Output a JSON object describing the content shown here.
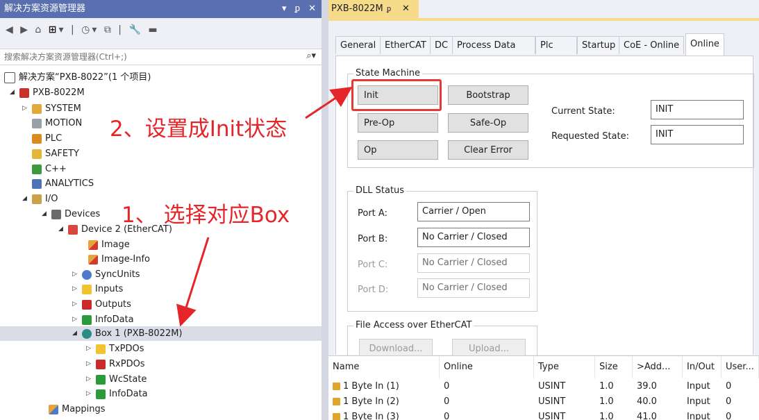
{
  "left_panel": {
    "title": "解决方案资源管理器",
    "title_controls": [
      "▾",
      "ᵱ",
      "✕"
    ],
    "search_placeholder": "搜索解决方案资源管理器(Ctrl+;)",
    "tree": [
      {
        "label": "解决方案“PXB-8022”(1 个项目)",
        "icon": "solution-icon"
      },
      {
        "label": "PXB-8022M",
        "icon": "project-icon"
      },
      {
        "label": "SYSTEM",
        "icon": "system-icon"
      },
      {
        "label": "MOTION",
        "icon": "motion-icon"
      },
      {
        "label": "PLC",
        "icon": "plc-icon"
      },
      {
        "label": "SAFETY",
        "icon": "safety-icon"
      },
      {
        "label": "C++",
        "icon": "cpp-icon"
      },
      {
        "label": "ANALYTICS",
        "icon": "analytics-icon"
      },
      {
        "label": "I/O",
        "icon": "io-icon"
      },
      {
        "label": "Devices",
        "icon": "devices-icon"
      },
      {
        "label": "Device 2 (EtherCAT)",
        "icon": "ethercat-device-icon"
      },
      {
        "label": "Image",
        "icon": "image-icon"
      },
      {
        "label": "Image-Info",
        "icon": "image-info-icon"
      },
      {
        "label": "SyncUnits",
        "icon": "syncunits-icon"
      },
      {
        "label": "Inputs",
        "icon": "inputs-icon"
      },
      {
        "label": "Outputs",
        "icon": "outputs-icon"
      },
      {
        "label": "InfoData",
        "icon": "infodata-icon"
      },
      {
        "label": "Box 1 (PXB-8022M)",
        "icon": "box-icon"
      },
      {
        "label": "TxPDOs",
        "icon": "txpdos-icon"
      },
      {
        "label": "RxPDOs",
        "icon": "rxpdos-icon"
      },
      {
        "label": "WcState",
        "icon": "wcstate-icon"
      },
      {
        "label": "InfoData",
        "icon": "infodata-icon"
      },
      {
        "label": "Mappings",
        "icon": "mappings-icon"
      }
    ]
  },
  "editor": {
    "doc_tab": {
      "label": "PXB-8022M",
      "pin": "ᵱ",
      "close": "✕"
    },
    "tabs": [
      "General",
      "EtherCAT",
      "DC",
      "Process Data",
      "Plc",
      "Startup",
      "CoE - Online",
      "Online"
    ],
    "active_tab": "Online",
    "state_machine": {
      "title": "State Machine",
      "buttons": {
        "init": "Init",
        "bootstrap": "Bootstrap",
        "preop": "Pre-Op",
        "safeop": "Safe-Op",
        "op": "Op",
        "clear_error": "Clear Error"
      },
      "current_state_label": "Current State:",
      "current_state_value": "INIT",
      "requested_state_label": "Requested State:",
      "requested_state_value": "INIT"
    },
    "dll_status": {
      "title": "DLL Status",
      "ports": [
        {
          "label": "Port A:",
          "value": "Carrier / Open",
          "enabled": true
        },
        {
          "label": "Port B:",
          "value": "No Carrier / Closed",
          "enabled": true
        },
        {
          "label": "Port C:",
          "value": "No Carrier / Closed",
          "enabled": false
        },
        {
          "label": "Port D:",
          "value": "No Carrier / Closed",
          "enabled": false
        }
      ]
    },
    "file_access": {
      "title": "File Access over EtherCAT",
      "download": "Download...",
      "upload": "Upload..."
    }
  },
  "grid": {
    "columns": [
      "Name",
      "Online",
      "Type",
      "Size",
      ">Add...",
      "In/Out",
      "User..."
    ],
    "rows": [
      [
        "1 Byte In (1)",
        "0",
        "USINT",
        "1.0",
        "39.0",
        "Input",
        "0"
      ],
      [
        "1 Byte In (2)",
        "0",
        "USINT",
        "1.0",
        "40.0",
        "Input",
        "0"
      ],
      [
        "1 Byte In (3)",
        "0",
        "USINT",
        "1.0",
        "41.0",
        "Input",
        "0"
      ]
    ]
  },
  "annotations": {
    "step1": "1、 选择对应Box",
    "step2": "2、设置成Init状态",
    "color": "#e4262a"
  },
  "colors": {
    "title_bar": "#5a6fb0",
    "doc_tab": "#f6dc8a",
    "selection": "#dadde8",
    "highlight": "#e53b36"
  }
}
